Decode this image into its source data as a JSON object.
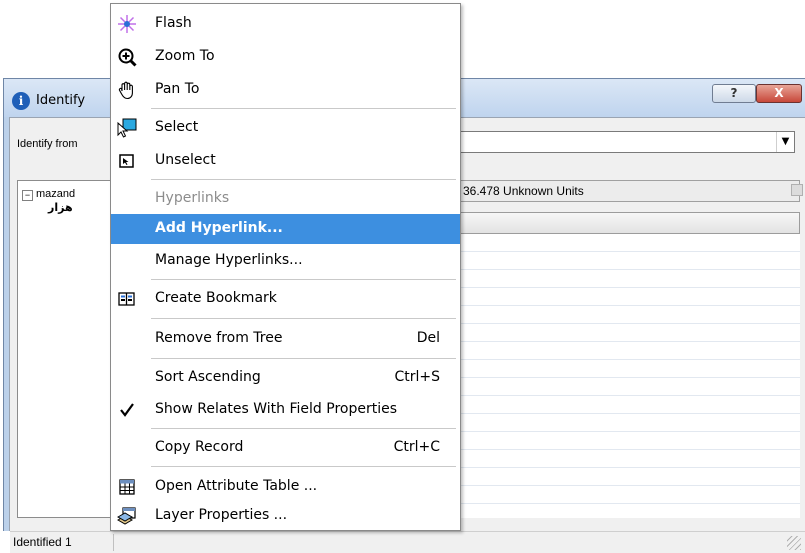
{
  "window": {
    "title": "Identify",
    "help_label": "?",
    "close_label": "X",
    "identify_from_label": "Identify from",
    "tree_root": "mazand",
    "tree_child": "هزار",
    "location_value": "36.478 Unknown Units",
    "status_text": "Identified 1"
  },
  "menu": {
    "items": [
      {
        "label": "Flash",
        "icon": "flash-icon"
      },
      {
        "label": "Zoom To",
        "icon": "zoom-in-icon"
      },
      {
        "label": "Pan To",
        "icon": "pan-hand-icon"
      },
      {
        "label": "Select",
        "icon": "select-feature-icon"
      },
      {
        "label": "Unselect",
        "icon": "unselect-feature-icon"
      },
      {
        "label": "Hyperlinks",
        "state": "disabled"
      },
      {
        "label": "Add Hyperlink...",
        "state": "highlighted"
      },
      {
        "label": "Manage Hyperlinks..."
      },
      {
        "label": "Create Bookmark",
        "icon": "bookmark-icon"
      },
      {
        "label": "Remove from Tree",
        "shortcut": "Del"
      },
      {
        "label": "Sort Ascending",
        "shortcut": "Ctrl+S"
      },
      {
        "label": "Show Relates With Field Properties",
        "icon": "checkmark-icon",
        "checked": true
      },
      {
        "label": "Copy Record",
        "shortcut": "Ctrl+C"
      },
      {
        "label": "Open Attribute Table ...",
        "icon": "table-icon"
      },
      {
        "label": "Layer Properties ...",
        "icon": "layer-properties-icon"
      }
    ]
  },
  "colors": {
    "highlight": "#3d8fe0",
    "title_bar": "#c8daf0",
    "close_button": "#c7483a"
  }
}
